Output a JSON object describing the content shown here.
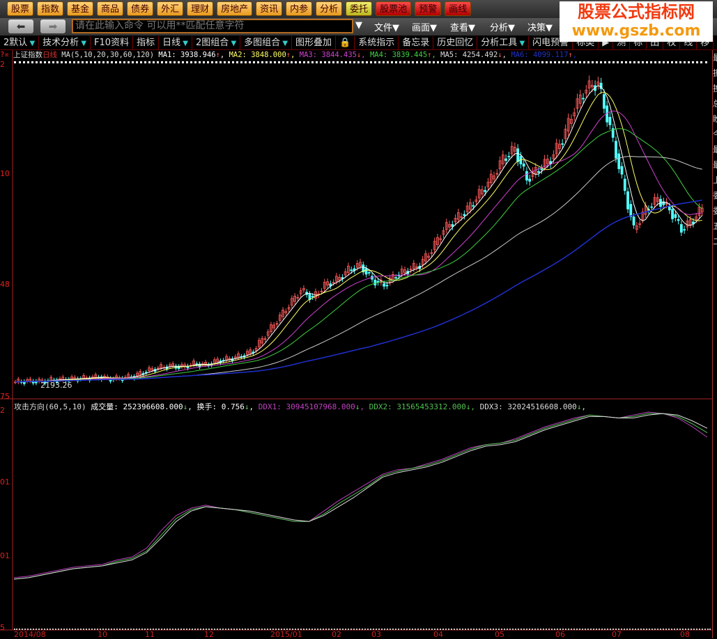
{
  "topbar": {
    "buttons": [
      {
        "label": "股票",
        "style": "o"
      },
      {
        "label": "指数",
        "style": "o"
      },
      {
        "label": "基金",
        "style": "o"
      },
      {
        "label": "商品",
        "style": "o"
      },
      {
        "label": "债券",
        "style": "o"
      },
      {
        "label": "外汇",
        "style": "o"
      },
      {
        "label": "理财",
        "style": "o"
      },
      {
        "label": "房地产",
        "style": "o"
      },
      {
        "label": "资讯",
        "style": "o"
      },
      {
        "label": "内参",
        "style": "o"
      },
      {
        "label": "分析",
        "style": "o"
      },
      {
        "label": "委托",
        "style": "y"
      },
      {
        "label": "股票池",
        "style": "r"
      },
      {
        "label": "预警",
        "style": "r"
      },
      {
        "label": "画线",
        "style": "r"
      }
    ]
  },
  "command": {
    "placeholder": "请在此输入命令    可以用**匹配任意字符"
  },
  "menus": [
    "文件▼",
    "画面▼",
    "查看▼",
    "分析▼",
    "决策▼"
  ],
  "toolbar": [
    {
      "label": "2默认",
      "dd": true
    },
    {
      "label": "技术分析",
      "dd": true
    },
    {
      "label": "F10资料"
    },
    {
      "label": "指标"
    },
    {
      "label": "日线",
      "dd": true
    },
    {
      "label": "2图组合",
      "dd": true
    },
    {
      "label": "多图组合",
      "dd": true
    },
    {
      "label": "图形叠加"
    },
    {
      "label": "🔒"
    },
    {
      "label": "系统指示"
    },
    {
      "label": "备忘录"
    },
    {
      "label": "历史回忆"
    },
    {
      "label": "分析工具",
      "dd": true
    },
    {
      "label": "闪电预警"
    },
    {
      "label": "标类"
    },
    {
      "label": "▶"
    },
    {
      "label": "测"
    },
    {
      "label": "标"
    },
    {
      "label": "田"
    },
    {
      "label": "权"
    },
    {
      "label": "线"
    },
    {
      "label": "移"
    },
    {
      "label": "▲"
    },
    {
      "label": "◪"
    }
  ],
  "info": {
    "name": "上证指数",
    "period": "日线",
    "ma_params": "MA(5,10,20,30,60,120)",
    "mas": [
      {
        "label": "MA1",
        "value": "3938.946",
        "arrow": "↑",
        "color": "#ffffff"
      },
      {
        "label": "MA2",
        "value": "3848.000",
        "arrow": "↑",
        "color": "#ffff66"
      },
      {
        "label": "MA3",
        "value": "3844.435",
        "arrow": "↓",
        "color": "#d040d0"
      },
      {
        "label": "MA4",
        "value": "3839.445",
        "arrow": "↑",
        "color": "#40d040"
      },
      {
        "label": "MA5",
        "value": "4254.492",
        "arrow": "↓",
        "color": "#dddddd"
      },
      {
        "label": "MA6",
        "value": "4099.117",
        "arrow": "↑",
        "color": "#2030c0"
      }
    ]
  },
  "lower_info": {
    "title": "攻击方向(60,5,10)",
    "items": [
      {
        "label": "成交量",
        "value": "252396608.000",
        "arrow": "↓",
        "color": "#ffffff"
      },
      {
        "label": "换手",
        "value": "0.756",
        "arrow": "↓",
        "color": "#ffffff"
      },
      {
        "label": "DDX1",
        "value": "30945107968.000",
        "arrow": "↓",
        "color": "#c040c0"
      },
      {
        "label": "DDX2",
        "value": "31565453312.000",
        "arrow": "↓",
        "color": "#50c050"
      },
      {
        "label": "DDX3",
        "value": "32024516608.000",
        "arrow": "↓",
        "color": "#dddddd"
      }
    ]
  },
  "axis_labels": {
    "upper": [
      "2",
      "10",
      "48",
      "75"
    ],
    "lower": [
      "2",
      "01",
      "01",
      "5"
    ]
  },
  "low_label": "2193.26",
  "dates": [
    "2014/08",
    "10",
    "11",
    "12",
    "2015/01",
    "02",
    "03",
    "04",
    "05",
    "06",
    "07",
    "08"
  ],
  "watermark": {
    "line1": "股票公式指标网",
    "line2": "www.gszb.com"
  },
  "side_text": [
    "最",
    "振",
    "换",
    "总",
    "盼",
    "今",
    "最",
    "最",
    "上",
    "委",
    "委",
    "五",
    "二"
  ],
  "chart_data": {
    "type": "candlestick",
    "ylim": [
      2030,
      5380
    ],
    "closes": [
      2190,
      2200,
      2196,
      2210,
      2215,
      2222,
      2230,
      2240,
      2220,
      2230,
      2250,
      2300,
      2330,
      2350,
      2340,
      2370,
      2360,
      2400,
      2420,
      2450,
      2500,
      2650,
      2800,
      2950,
      3100,
      3020,
      3150,
      3200,
      3300,
      3350,
      3200,
      3150,
      3250,
      3300,
      3350,
      3500,
      3700,
      3800,
      3900,
      4050,
      4200,
      4400,
      4500,
      4200,
      4300,
      4400,
      4600,
      4900,
      5100,
      5150,
      4700,
      4200,
      3700,
      3900,
      4000,
      3900,
      3700,
      3800,
      3950
    ],
    "low_point": 2193.26,
    "ddx": {
      "series": [
        {
          "name": "DDX1",
          "color": "#c040c0",
          "values": [
            10,
            11,
            13,
            15,
            17,
            18,
            19,
            22,
            24,
            30,
            42,
            52,
            57,
            59,
            57,
            56,
            54,
            52,
            50,
            48,
            48,
            55,
            62,
            68,
            74,
            80,
            83,
            84,
            87,
            90,
            94,
            98,
            100,
            101,
            104,
            108,
            112,
            115,
            118,
            120,
            119,
            118,
            120,
            122,
            121,
            118,
            112,
            105
          ]
        },
        {
          "name": "DDX2",
          "color": "#50c050",
          "values": [
            9,
            10,
            12,
            14,
            16,
            17,
            18,
            21,
            23,
            28,
            39,
            50,
            56,
            58,
            57,
            56,
            54,
            52,
            50,
            48,
            48,
            53,
            60,
            66,
            72,
            79,
            82,
            84,
            86,
            89,
            93,
            97,
            100,
            101,
            103,
            107,
            111,
            114,
            117,
            120,
            119,
            118,
            119,
            121,
            121,
            119,
            114,
            108
          ]
        },
        {
          "name": "DDX3",
          "color": "#dddddd",
          "values": [
            9,
            10,
            12,
            14,
            16,
            17,
            18,
            20,
            22,
            27,
            37,
            48,
            55,
            58,
            57,
            56,
            55,
            53,
            51,
            49,
            48,
            52,
            58,
            64,
            71,
            78,
            81,
            83,
            85,
            88,
            92,
            96,
            99,
            100,
            102,
            106,
            110,
            113,
            116,
            119,
            119,
            118,
            118,
            120,
            121,
            120,
            116,
            111
          ]
        }
      ]
    }
  }
}
